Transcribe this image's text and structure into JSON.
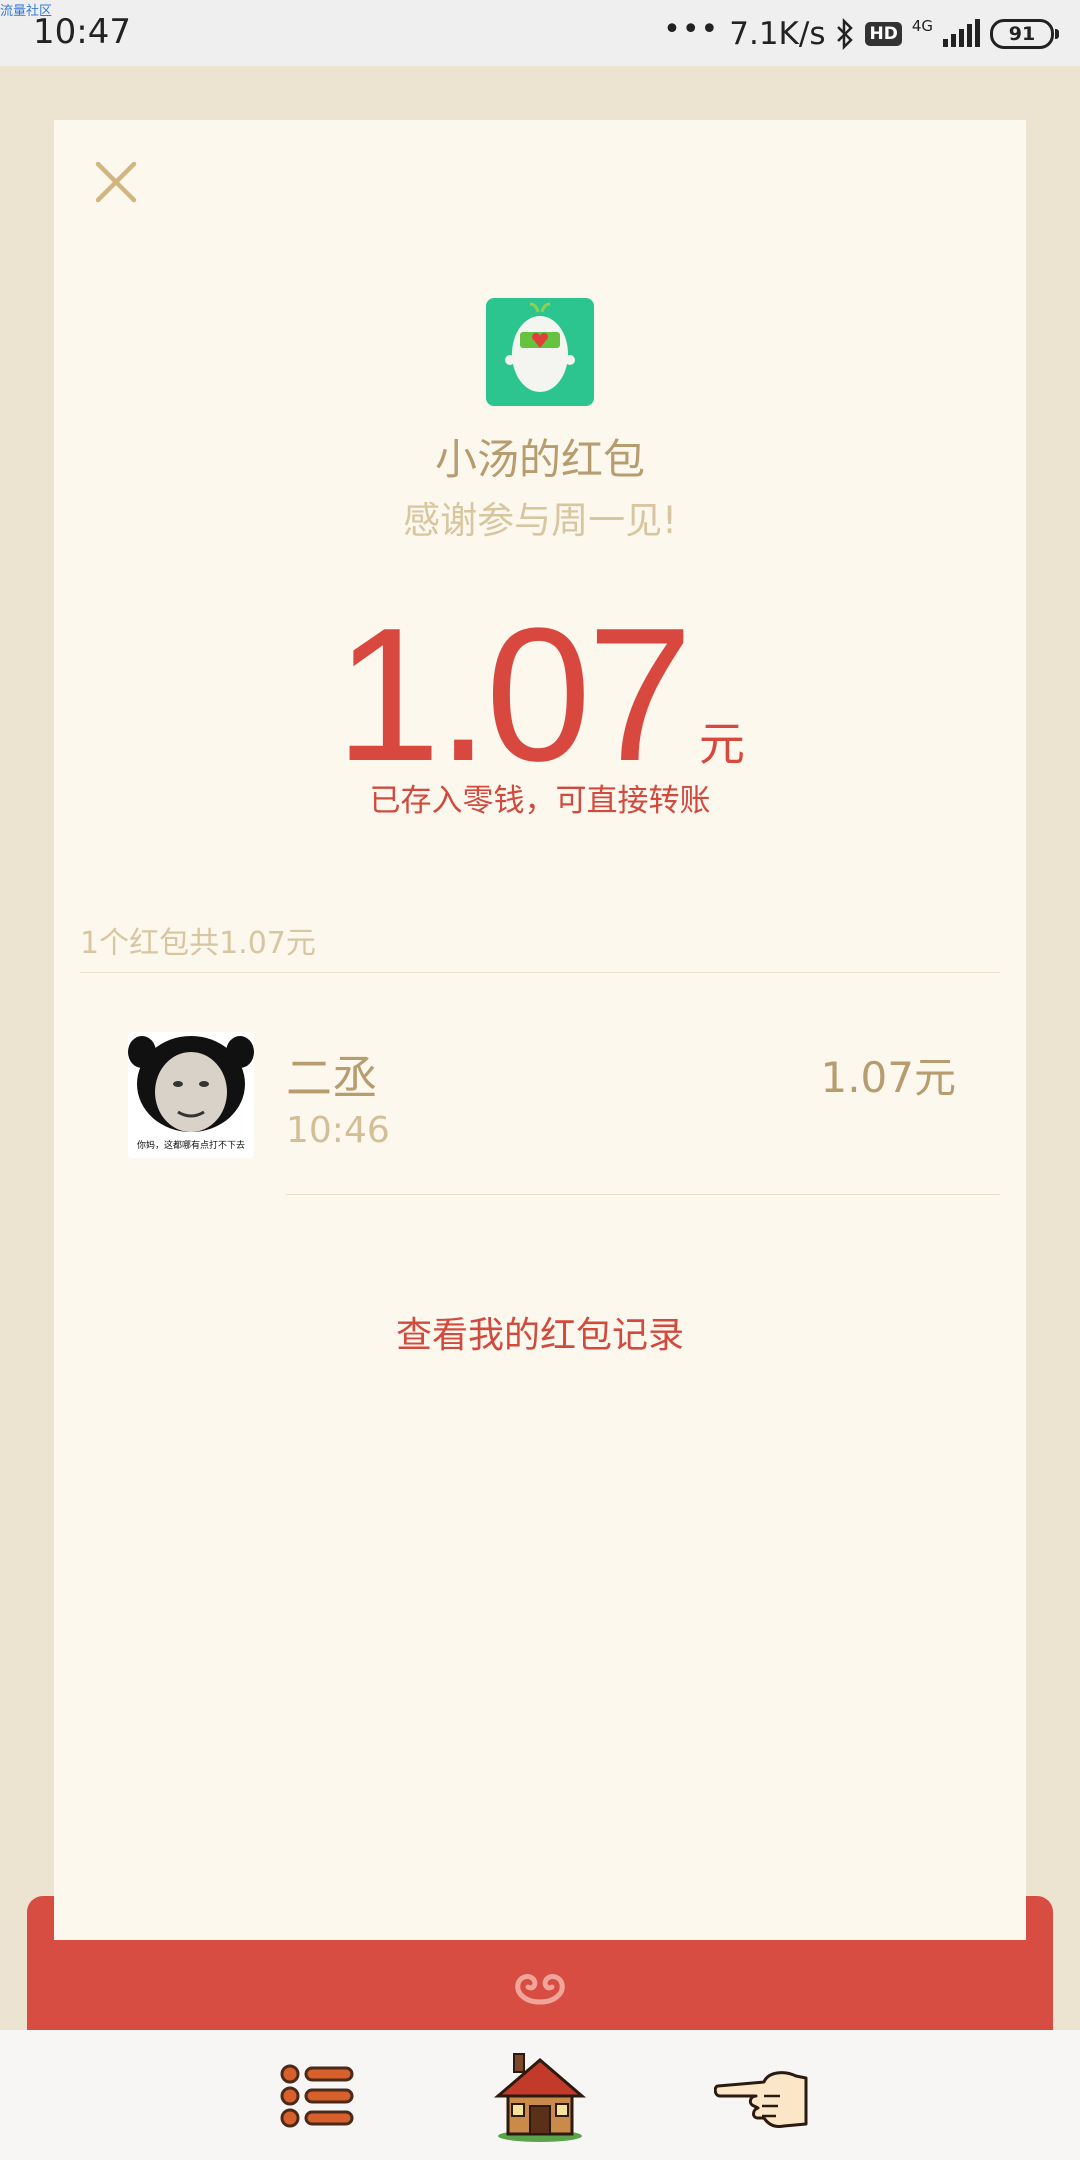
{
  "status_bar": {
    "watermark": "流量社区",
    "time": "10:47",
    "net_speed": "7.1K/s",
    "hd_badge": "HD",
    "network": "4G",
    "battery": "91"
  },
  "header": {
    "sender_name": "小汤的红包",
    "greeting": "感谢参与周一见!"
  },
  "amount": {
    "value": "1.07",
    "unit": "元",
    "note": "已存入零钱，可直接转账"
  },
  "summary": "1个红包共1.07元",
  "receivers": [
    {
      "name": "二丞",
      "time": "10:46",
      "amount": "1.07元",
      "avatar_caption": "你妈，这都哪有点打不下去"
    }
  ],
  "records_link": "查看我的红包记录",
  "colors": {
    "accent_red": "#d84d42",
    "gold_text": "#b79c6f",
    "card_bg": "#fcf8ed",
    "page_bg": "#ece4d0",
    "sender_avatar_bg": "#2dc58f"
  },
  "icons": [
    "close-icon",
    "menu-list-icon",
    "house-icon",
    "pointing-hand-icon",
    "swirl-icon",
    "bluetooth-icon"
  ]
}
